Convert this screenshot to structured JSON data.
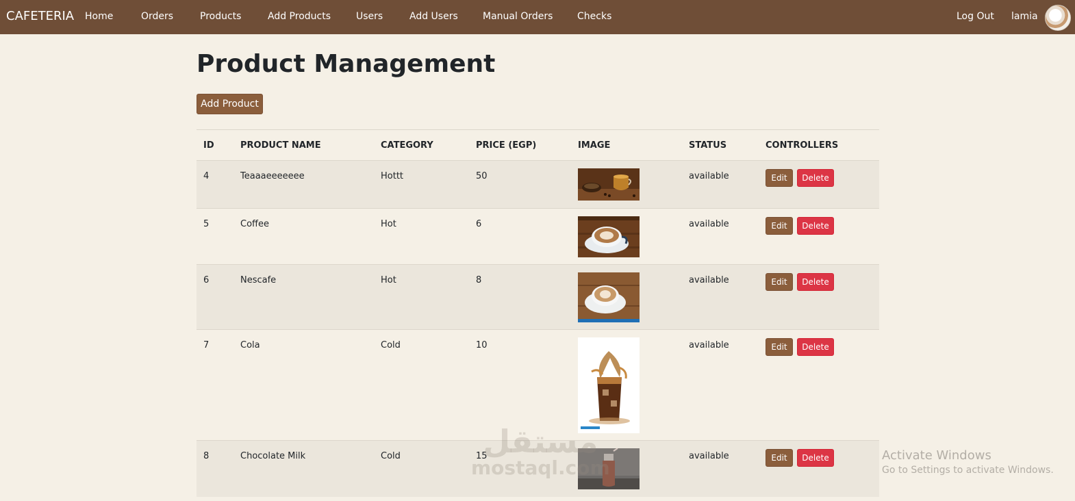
{
  "navbar": {
    "brand": "CAFETERIA",
    "items": [
      "Home",
      "Orders",
      "Products",
      "Add Products",
      "Users",
      "Add Users",
      "Manual Orders",
      "Checks"
    ],
    "logout": "Log Out",
    "username": "lamia"
  },
  "page": {
    "title": "Product Management",
    "add_button": "Add Product"
  },
  "table": {
    "headers": [
      "ID",
      "PRODUCT NAME",
      "CATEGORY",
      "PRICE (EGP)",
      "IMAGE",
      "STATUS",
      "CONTROLLERS"
    ],
    "rows": [
      {
        "id": "4",
        "name": "Teaaaeeeeeee",
        "category": "Hottt",
        "price": "50",
        "status": "available",
        "image": "tea-image"
      },
      {
        "id": "5",
        "name": "Coffee",
        "category": "Hot",
        "price": "6",
        "status": "available",
        "image": "coffee-image"
      },
      {
        "id": "6",
        "name": "Nescafe",
        "category": "Hot",
        "price": "8",
        "status": "available",
        "image": "nescafe-image"
      },
      {
        "id": "7",
        "name": "Cola",
        "category": "Cold",
        "price": "10",
        "status": "available",
        "image": "cola-image"
      },
      {
        "id": "8",
        "name": "Chocolate Milk",
        "category": "Cold",
        "price": "15",
        "status": "available",
        "image": "chocolate-milk-image"
      }
    ],
    "edit_label": "Edit",
    "delete_label": "Delete"
  },
  "overlay": {
    "activate_title": "Activate Windows",
    "activate_sub": "Go to Settings to activate Windows.",
    "watermark_arabic": "مستقل",
    "watermark_latin": "mostaql.com"
  },
  "colors": {
    "navbar": "#6f4e37",
    "background": "#f5f0e6",
    "primary_button": "#8b5e3c",
    "danger_button": "#dc3545",
    "striped_row": "#ebe6dc"
  }
}
